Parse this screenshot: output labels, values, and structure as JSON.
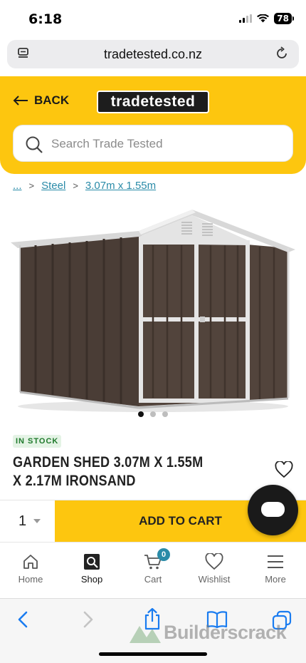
{
  "status_bar": {
    "time": "6:18",
    "battery": "78"
  },
  "browser": {
    "url": "tradetested.co.nz"
  },
  "header": {
    "back_label": "BACK",
    "logo_text": "tradetested",
    "search_placeholder": "Search Trade Tested"
  },
  "breadcrumb": {
    "ellipsis": "...",
    "items": [
      "Steel",
      "3.07m x 1.55m"
    ]
  },
  "product": {
    "stock_label": "IN STOCK",
    "title": "GARDEN SHED 3.07M X 1.55M X 2.17M IRONSAND",
    "image_count": 3,
    "active_image": 1
  },
  "purchase": {
    "quantity": "1",
    "add_to_cart_label": "ADD TO CART"
  },
  "bottom_nav": {
    "items": [
      {
        "label": "Home",
        "icon": "home-icon"
      },
      {
        "label": "Shop",
        "icon": "shop-icon"
      },
      {
        "label": "Cart",
        "icon": "cart-icon",
        "badge": "0"
      },
      {
        "label": "Wishlist",
        "icon": "heart-icon"
      },
      {
        "label": "More",
        "icon": "menu-icon"
      }
    ]
  },
  "watermark": "Builderscrack",
  "colors": {
    "brand_yellow": "#fdc60f",
    "link_teal": "#2a8ba8",
    "stock_green": "#1f7a2c",
    "safari_blue": "#1a7cf0"
  }
}
